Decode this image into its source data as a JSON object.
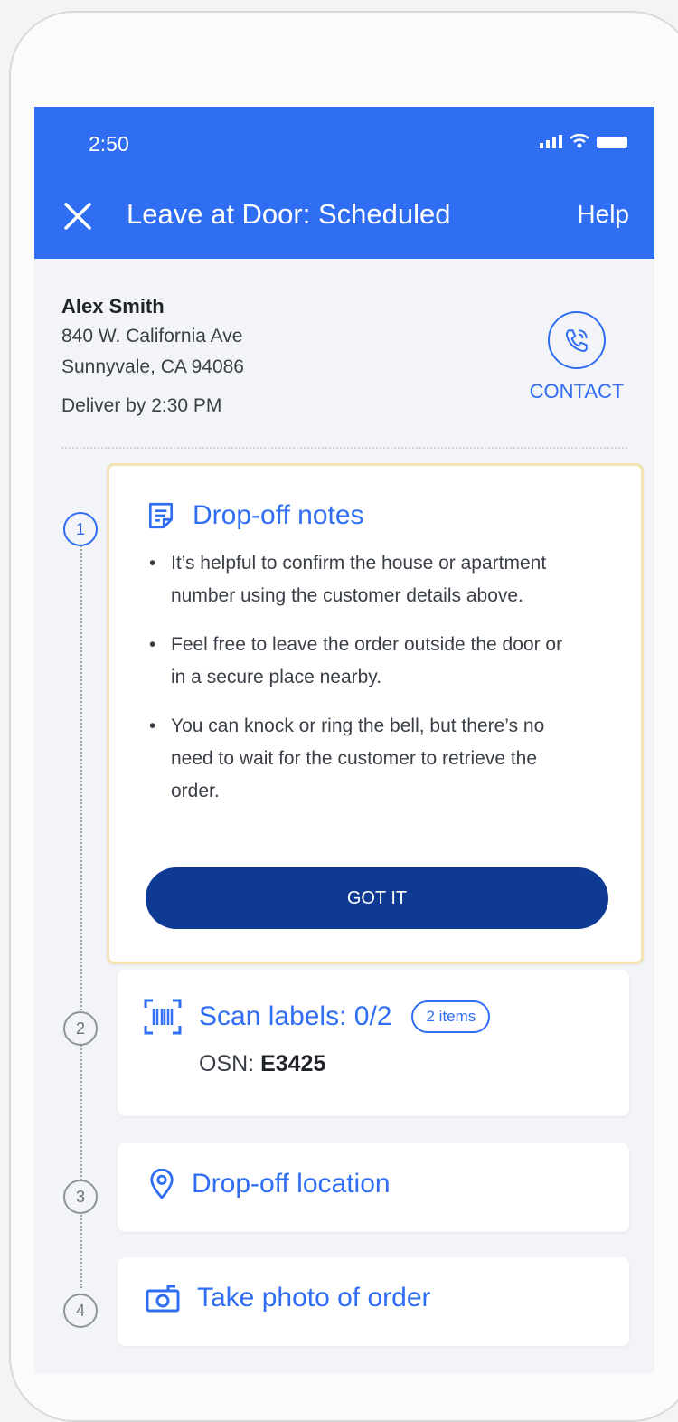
{
  "status_bar": {
    "time": "2:50"
  },
  "header": {
    "title": "Leave at Door: Scheduled",
    "help_label": "Help"
  },
  "customer": {
    "name": "Alex Smith",
    "address_line1": "840 W. California Ave",
    "address_line2": "Sunnyvale, CA 94086",
    "deliver_by": "Deliver by 2:30 PM",
    "contact_label": "CONTACT"
  },
  "steps": [
    {
      "number": "1",
      "title": "Drop-off notes"
    },
    {
      "number": "2",
      "title": "Scan labels: 0/2",
      "badge": "2 items",
      "osn_label": "OSN:",
      "osn_value": "E3425"
    },
    {
      "number": "3",
      "title": "Drop-off location"
    },
    {
      "number": "4",
      "title": "Take photo of order"
    }
  ],
  "notes": [
    "It’s helpful to confirm the house or apartment number using the customer details above.",
    "Feel free to leave the order outside the door or in a secure place nearby.",
    "You can knock or ring the bell, but there’s no need to wait for the customer to retrieve the order."
  ],
  "got_it_label": "GOT IT",
  "colors": {
    "primary": "#2f6ef2",
    "button_dark": "#0f3a94",
    "highlight_border": "#f2e3b0"
  }
}
